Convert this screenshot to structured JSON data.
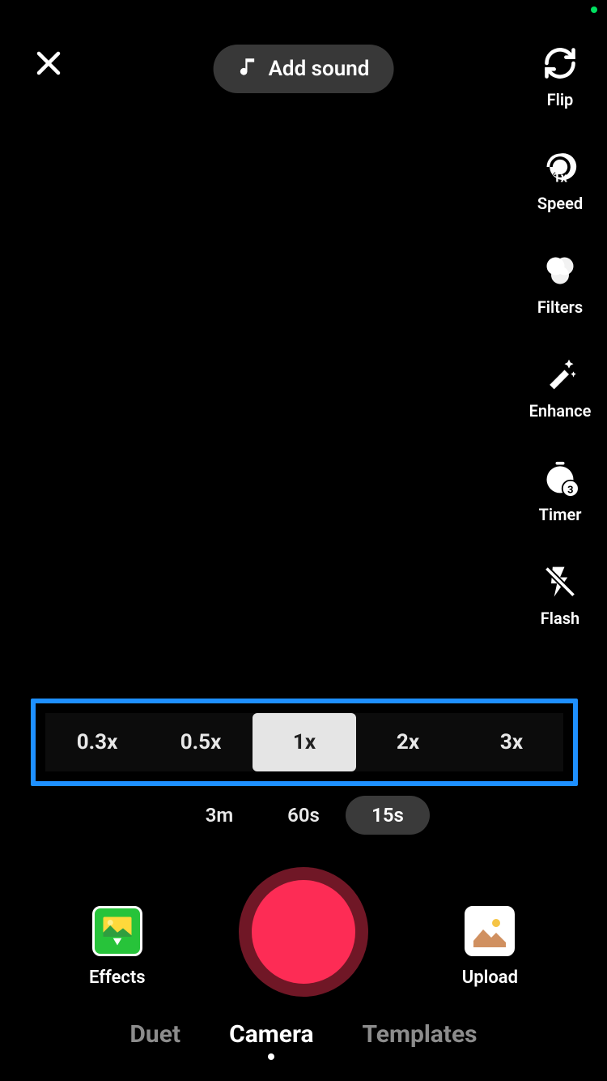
{
  "header": {
    "add_sound_label": "Add sound"
  },
  "side": {
    "flip": "Flip",
    "speed": "Speed",
    "speed_badge": "1x",
    "filters": "Filters",
    "enhance": "Enhance",
    "timer": "Timer",
    "timer_badge": "3",
    "flash": "Flash"
  },
  "speed_options": [
    "0.3x",
    "0.5x",
    "1x",
    "2x",
    "3x"
  ],
  "speed_selected_index": 2,
  "duration_options": [
    "3m",
    "60s",
    "15s"
  ],
  "duration_selected_index": 2,
  "bottom": {
    "effects_label": "Effects",
    "upload_label": "Upload"
  },
  "modes": [
    "Duet",
    "Camera",
    "Templates"
  ],
  "mode_selected_index": 1
}
